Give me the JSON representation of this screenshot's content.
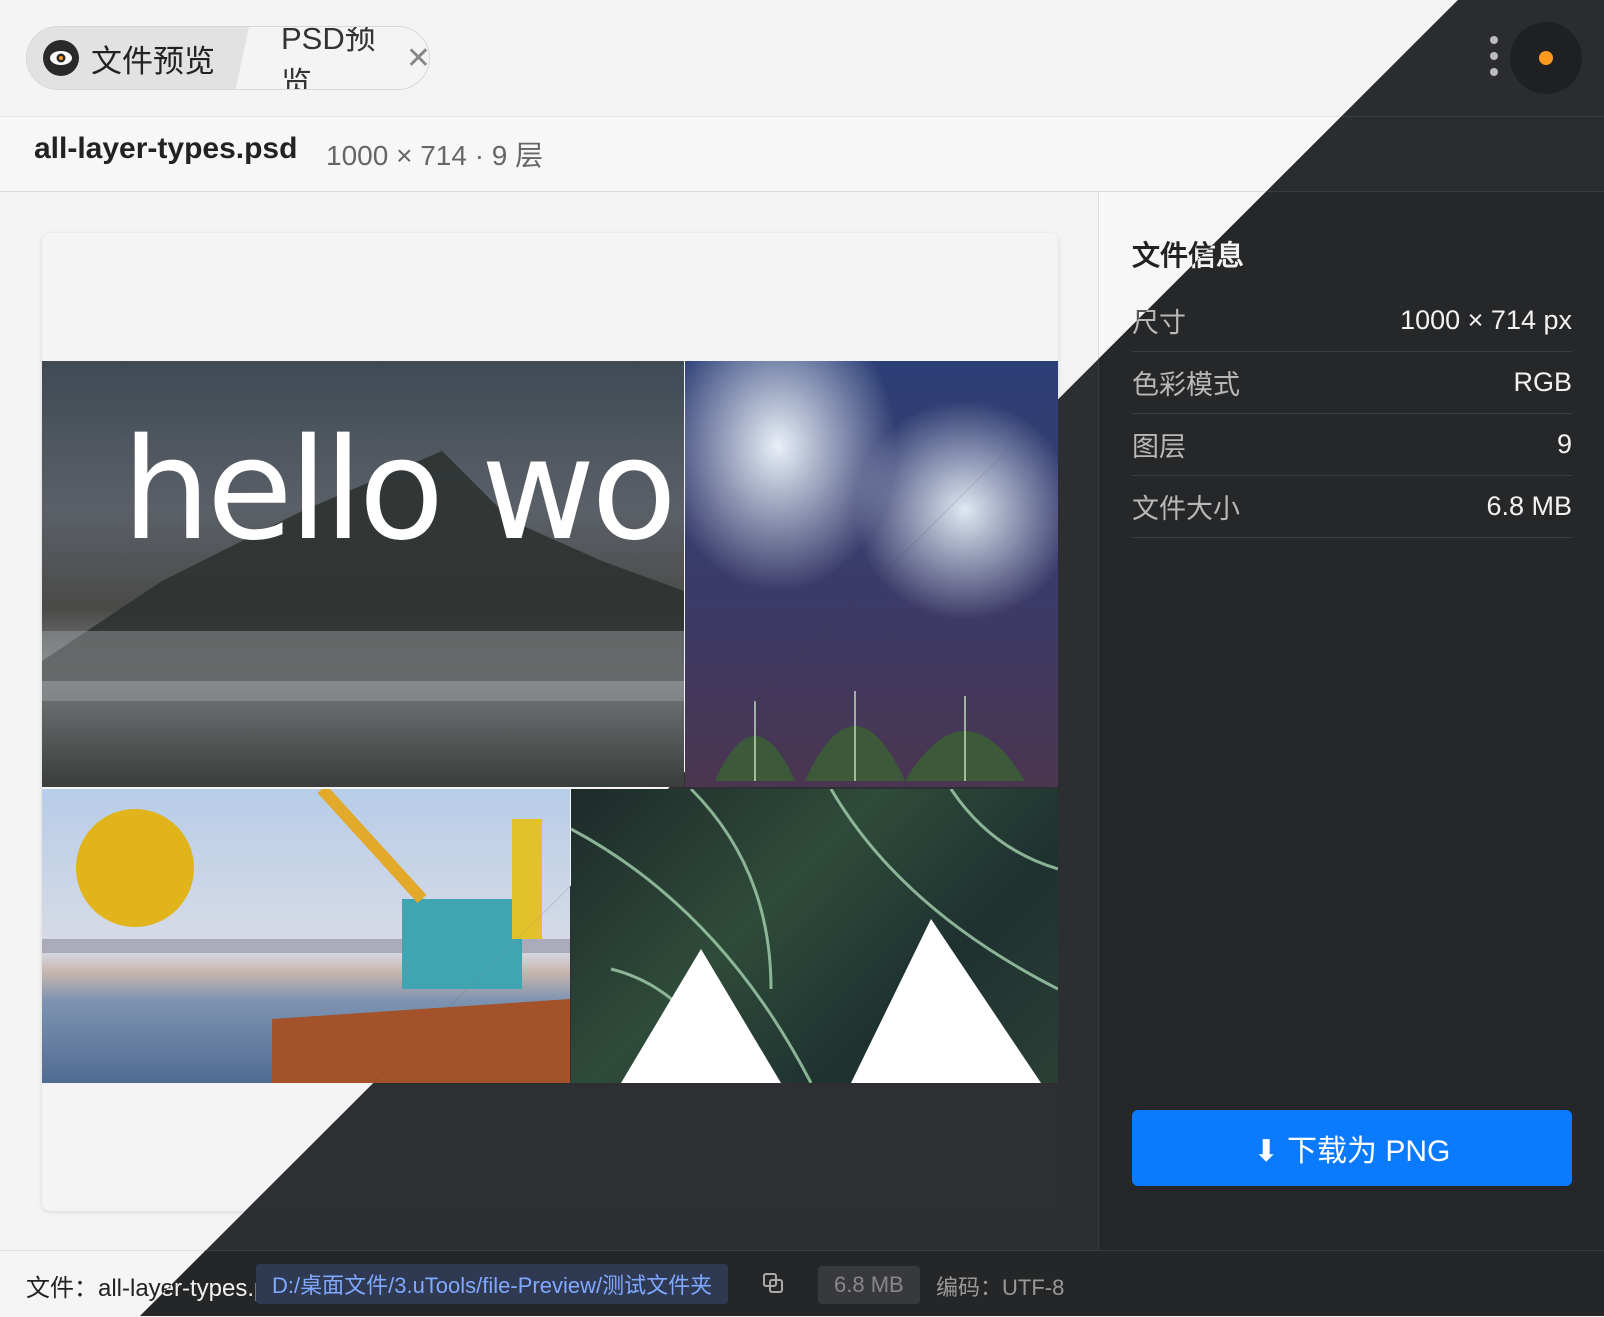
{
  "tabs": [
    {
      "label": "文件预览"
    },
    {
      "label": "PSD预览"
    }
  ],
  "file": {
    "name": "all-layer-types.psd",
    "meta": "1000 × 714 · 9 层"
  },
  "preview": {
    "overlay_text": "hello world"
  },
  "panel": {
    "title": "文件信息",
    "rows": [
      {
        "label": "尺寸",
        "value": "1000 × 714 px"
      },
      {
        "label": "色彩模式",
        "value": "RGB"
      },
      {
        "label": "图层",
        "value": "9"
      },
      {
        "label": "文件大小",
        "value": "6.8 MB"
      }
    ],
    "download_label": "⬇ 下载为 PNG"
  },
  "status": {
    "file_label": "文件：all-layer-types.psd",
    "path": "D:/桌面文件/3.uTools/file-Preview/测试文件夹",
    "size": "6.8 MB",
    "encoding": "编码：UTF-8"
  },
  "colors": {
    "accent": "#0a7aff",
    "logo_dot": "#ff9a1f",
    "sun": "#e0b41a"
  },
  "icons": [
    "eye-icon",
    "close-icon",
    "more-vertical-icon",
    "app-logo-icon",
    "copy-icon",
    "download-icon"
  ]
}
